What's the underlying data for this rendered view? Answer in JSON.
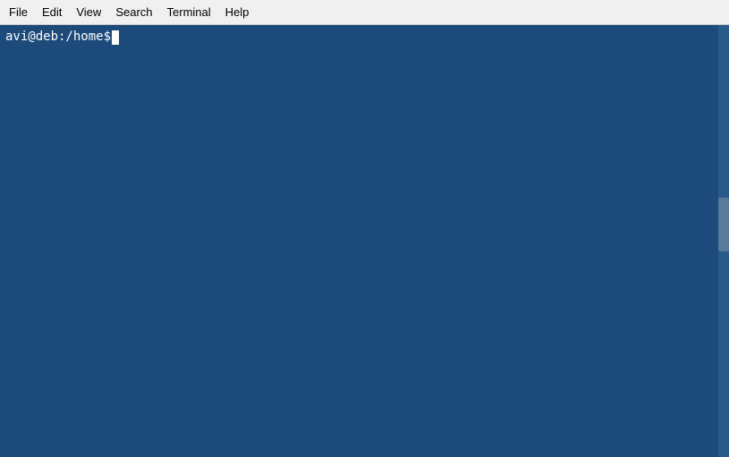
{
  "menubar": {
    "items": [
      {
        "label": "File",
        "id": "file"
      },
      {
        "label": "Edit",
        "id": "edit"
      },
      {
        "label": "View",
        "id": "view"
      },
      {
        "label": "Search",
        "id": "search"
      },
      {
        "label": "Terminal",
        "id": "terminal"
      },
      {
        "label": "Help",
        "id": "help"
      }
    ]
  },
  "terminal": {
    "prompt": "avi@deb:/home$",
    "bg_color": "#1c4a7a"
  }
}
